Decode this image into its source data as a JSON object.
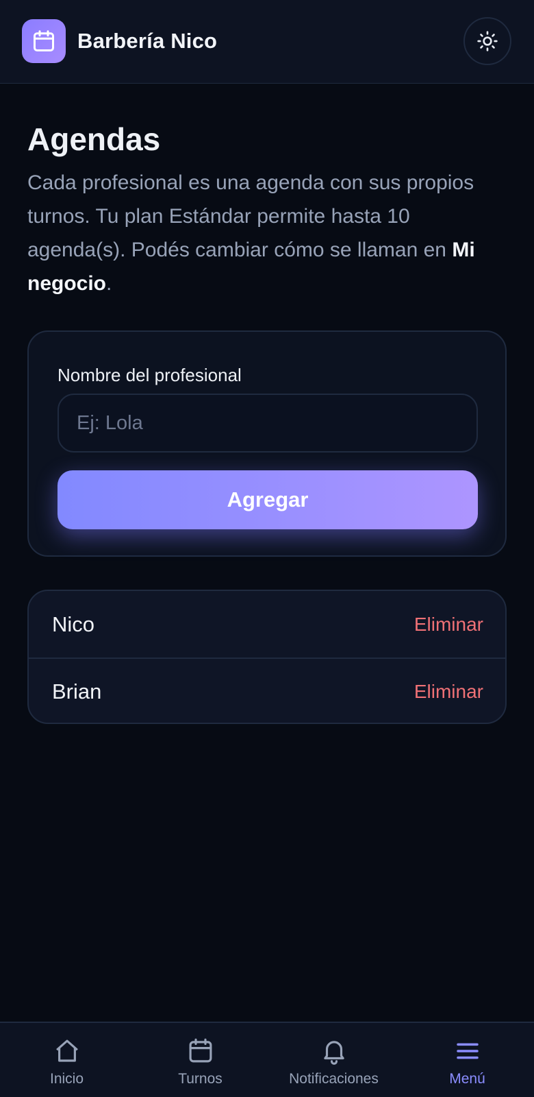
{
  "header": {
    "brand": "Barbería Nico",
    "logo_icon": "calendar-icon",
    "theme_icon": "sun-icon"
  },
  "main": {
    "title": "Agendas",
    "description_text": "Cada profesional es una agenda con sus propios turnos. Tu plan Estándar permite hasta 10 agenda(s). Podés cambiar cómo se llaman en ",
    "description_link": "Mi negocio",
    "description_end": "."
  },
  "form": {
    "label": "Nombre del profesional",
    "placeholder": "Ej: Lola",
    "value": "",
    "submit_label": "Agregar"
  },
  "agendas": [
    {
      "name": "Nico",
      "action": "Eliminar"
    },
    {
      "name": "Brian",
      "action": "Eliminar"
    }
  ],
  "nav": {
    "items": [
      {
        "label": "Inicio",
        "icon": "home-icon"
      },
      {
        "label": "Turnos",
        "icon": "calendar-icon"
      },
      {
        "label": "Notificaciones",
        "icon": "bell-icon"
      },
      {
        "label": "Menú",
        "icon": "menu-icon"
      }
    ],
    "active": "Menú"
  },
  "colors": {
    "background": "#070b14",
    "accent_start": "#8289ff",
    "accent_end": "#ad95ff",
    "danger": "#f07176",
    "active_nav": "#8b8dff"
  }
}
